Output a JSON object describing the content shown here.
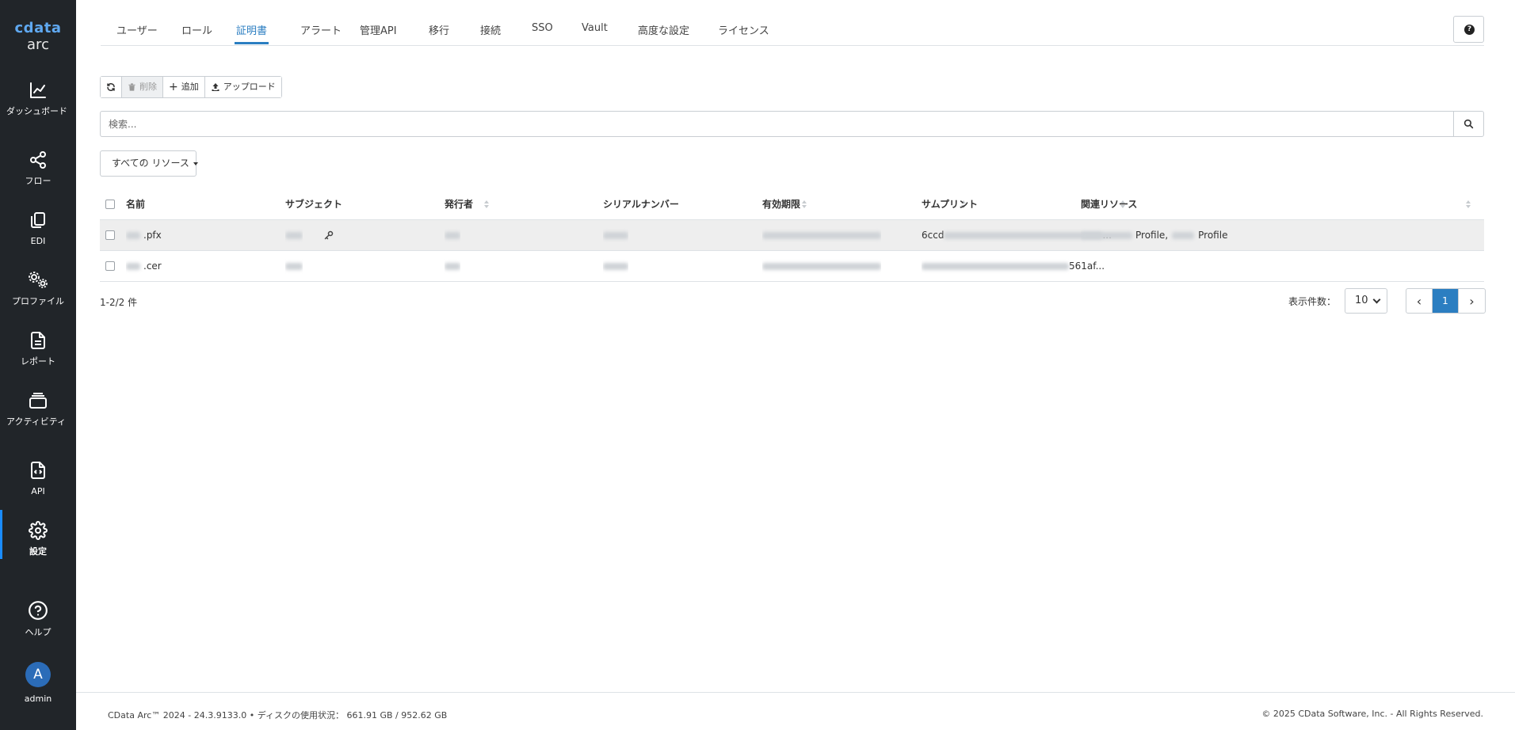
{
  "logo": {
    "brand": "cdata",
    "product": "arc"
  },
  "sidebar": {
    "items": [
      {
        "id": "dashboard",
        "label": "ダッシュボード",
        "icon": "chart-line-icon"
      },
      {
        "id": "flow",
        "label": "フロー",
        "icon": "share-nodes-icon"
      },
      {
        "id": "edi",
        "label": "EDI",
        "icon": "copy-icon"
      },
      {
        "id": "profile",
        "label": "プロファイル",
        "icon": "gears-icon"
      },
      {
        "id": "report",
        "label": "レポート",
        "icon": "file-text-icon"
      },
      {
        "id": "activity",
        "label": "アクティビティ",
        "icon": "layers-icon"
      },
      {
        "id": "api",
        "label": "API",
        "icon": "file-code-icon"
      },
      {
        "id": "settings",
        "label": "設定",
        "icon": "gear-icon",
        "active": true
      }
    ],
    "help": {
      "label": "ヘルプ",
      "icon": "question-circle-icon"
    },
    "user": {
      "initial": "A",
      "name": "admin"
    }
  },
  "tabs": [
    {
      "label": "ユーザー"
    },
    {
      "label": "ロール"
    },
    {
      "label": "証明書",
      "active": true
    },
    {
      "label": "アラート"
    },
    {
      "label": "管理API"
    },
    {
      "label": "移行"
    },
    {
      "label": "接続"
    },
    {
      "label": "SSO"
    },
    {
      "label": "Vault"
    },
    {
      "label": "高度な設定"
    },
    {
      "label": "ライセンス"
    }
  ],
  "toolbar": {
    "refresh_icon": "refresh-icon",
    "delete_label": "削除",
    "add_label": "追加",
    "upload_label": "アップロード"
  },
  "search": {
    "placeholder": "検索...",
    "value": ""
  },
  "filter": {
    "label": "すべての リソース"
  },
  "table": {
    "columns": [
      "名前",
      "サブジェクト",
      "発行者",
      "シリアルナンバー",
      "有効期限",
      "サムプリント",
      "関連リソース"
    ],
    "rows": [
      {
        "name_suffix": ".pfx",
        "has_private_key": true,
        "thumbprint_start": "6ccd",
        "thumbprint_end": "...",
        "resources": [
          "Profile,",
          "Profile"
        ],
        "selected": true
      },
      {
        "name_suffix": ".cer",
        "has_private_key": false,
        "thumbprint_start": "",
        "thumbprint_end": "561af...",
        "resources": [],
        "selected": false
      }
    ]
  },
  "pagination": {
    "count_text": "1-2/2 件",
    "page_size_label": "表示件数：",
    "page_size": "10",
    "prev": "‹",
    "current_page": "1",
    "next": "›"
  },
  "footer": {
    "version": "CData Arc™ 2024 - 24.3.9133.0",
    "separator": "•",
    "disk_label": "ディスクの使用状況：",
    "disk_value": "661.91 GB / 952.62 GB",
    "copyright": "© 2025 CData Software, Inc. - All Rights Reserved."
  }
}
